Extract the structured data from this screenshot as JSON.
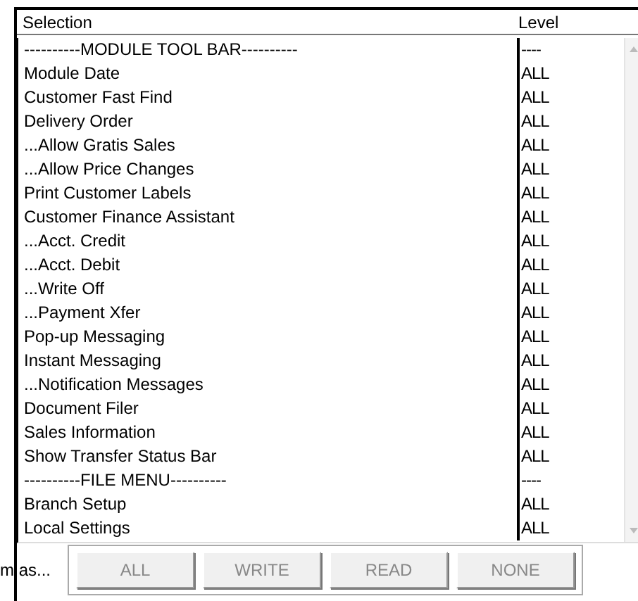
{
  "table": {
    "columns": [
      "Selection",
      "Level"
    ],
    "rows": [
      {
        "selection": "----------MODULE TOOL BAR----------",
        "level": "----"
      },
      {
        "selection": "Module Date",
        "level": "ALL"
      },
      {
        "selection": "Customer Fast Find",
        "level": "ALL"
      },
      {
        "selection": "Delivery Order",
        "level": "ALL"
      },
      {
        "selection": "...Allow Gratis Sales",
        "level": "ALL"
      },
      {
        "selection": "...Allow Price Changes",
        "level": "ALL"
      },
      {
        "selection": "Print Customer Labels",
        "level": "ALL"
      },
      {
        "selection": "Customer Finance Assistant",
        "level": "ALL"
      },
      {
        "selection": "...Acct. Credit",
        "level": "ALL"
      },
      {
        "selection": "...Acct. Debit",
        "level": "ALL"
      },
      {
        "selection": "...Write Off",
        "level": "ALL"
      },
      {
        "selection": "...Payment Xfer",
        "level": "ALL"
      },
      {
        "selection": "Pop-up Messaging",
        "level": "ALL"
      },
      {
        "selection": "Instant Messaging",
        "level": "ALL"
      },
      {
        "selection": "...Notification Messages",
        "level": "ALL"
      },
      {
        "selection": "Document Filer",
        "level": "ALL"
      },
      {
        "selection": "Sales Information",
        "level": "ALL"
      },
      {
        "selection": "Show Transfer Status Bar",
        "level": "ALL"
      },
      {
        "selection": "----------FILE MENU----------",
        "level": "----"
      },
      {
        "selection": "Branch Setup",
        "level": "ALL"
      },
      {
        "selection": "Local Settings",
        "level": "ALL"
      }
    ]
  },
  "set_label": "m as...",
  "buttons": [
    {
      "label": "ALL",
      "disabled": true
    },
    {
      "label": "WRITE",
      "disabled": true
    },
    {
      "label": "READ",
      "disabled": true
    },
    {
      "label": "NONE",
      "disabled": true
    }
  ]
}
